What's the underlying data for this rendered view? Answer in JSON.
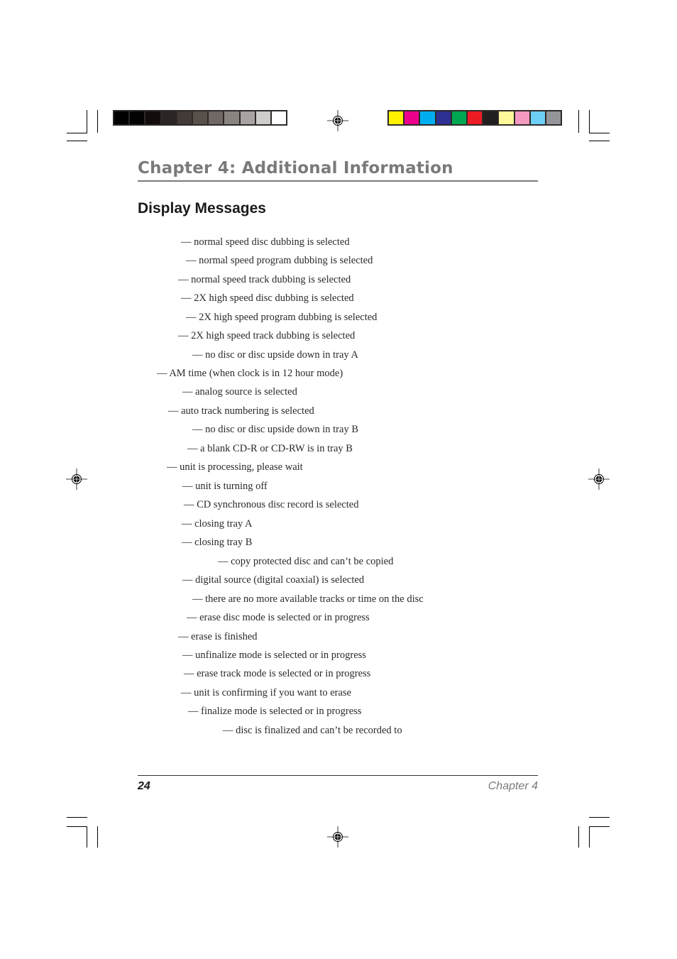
{
  "header": {
    "chapter_title": "Chapter 4: Additional Information",
    "section_title": "Display Messages"
  },
  "messages": [
    "— normal speed disc dubbing is selected",
    "— normal speed program dubbing is selected",
    "— normal speed track dubbing is selected",
    "— 2X high speed disc dubbing is selected",
    "— 2X high speed program dubbing is selected",
    "— 2X high speed track dubbing is selected",
    "— no disc or disc upside down in tray A",
    "— AM time (when clock is in 12 hour mode)",
    "— analog source is selected",
    "— auto track numbering is selected",
    "— no disc or disc upside down in tray B",
    "— a blank CD-R or CD-RW is in tray B",
    "— unit is processing, please wait",
    "— unit is turning off",
    "— CD synchronous disc record is selected",
    "— closing tray A",
    "— closing tray B",
    "— copy protected disc and can’t be copied",
    "— digital source (digital coaxial) is selected",
    "— there are no more available tracks or time on the disc",
    "— erase disc mode is selected or in progress",
    "— erase is finished",
    "— unfinalize mode is selected or in progress",
    "— erase track mode is selected or in progress",
    "— unit is confirming if you want to erase",
    "— finalize mode is selected or in progress",
    "— disc is finalized and can’t be recorded to"
  ],
  "footer": {
    "page_number": "24",
    "chapter_label": "Chapter 4"
  },
  "print_marks": {
    "gray_scale_colors": [
      "#000000",
      "#030303",
      "#120d0b",
      "#2a2523",
      "#433b38",
      "#59504c",
      "#6f6865",
      "#8a8481",
      "#a8a3a1",
      "#cfcccb",
      "#ffffff"
    ],
    "process_colors": [
      "#fff200",
      "#ec008c",
      "#00aeef",
      "#2e3192",
      "#00a651",
      "#ed1c24",
      "#231f20",
      "#fff799",
      "#f49ac1",
      "#6dcff6",
      "#939598"
    ]
  }
}
